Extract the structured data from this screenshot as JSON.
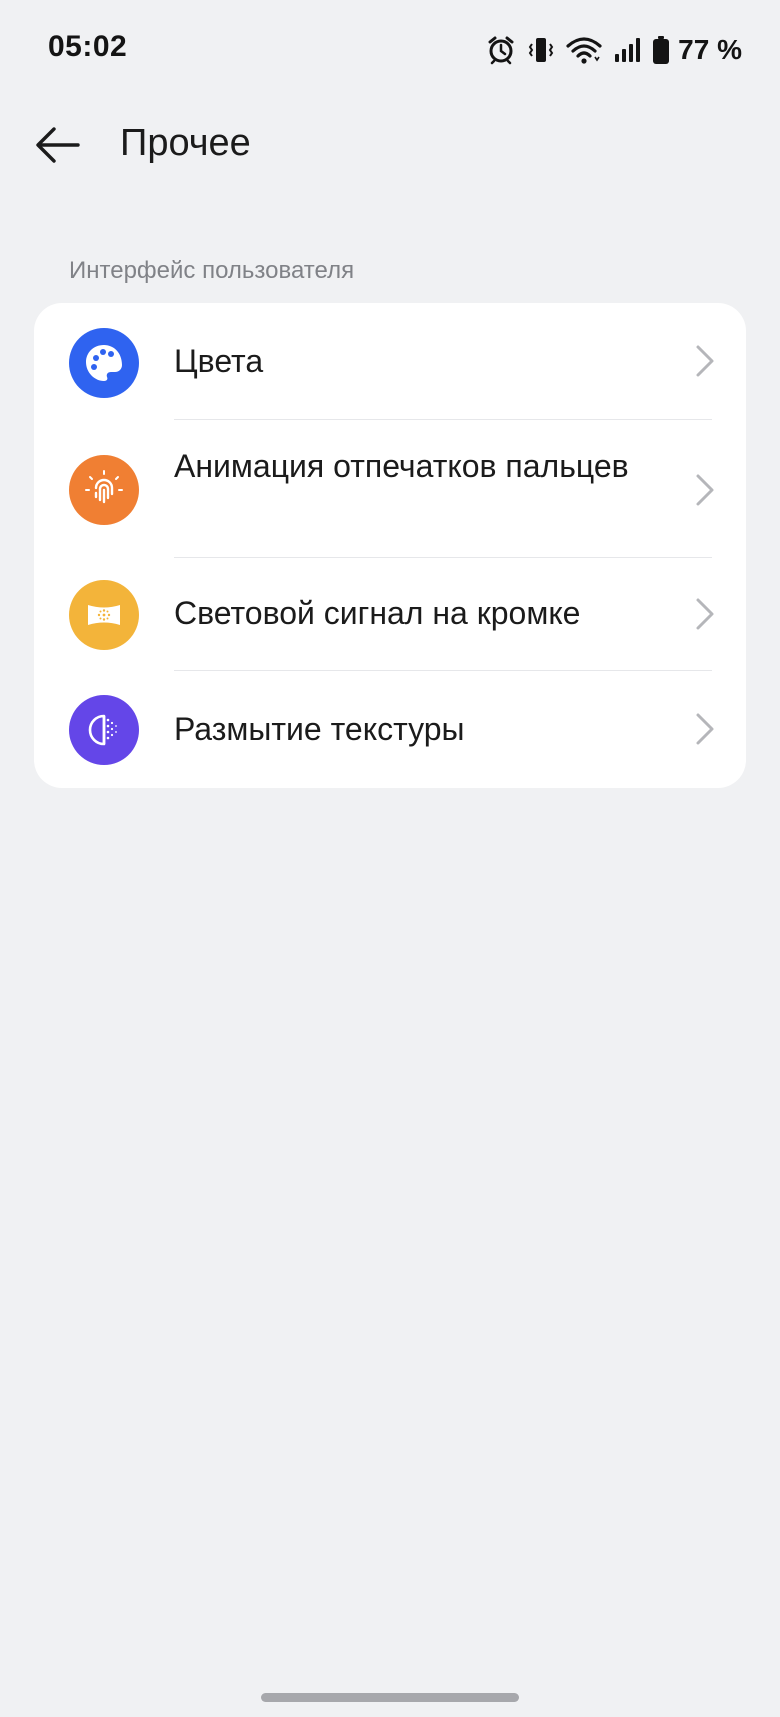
{
  "status_bar": {
    "time": "05:02",
    "battery_percent": "77 %",
    "icons": [
      "alarm-icon",
      "vibrate-icon",
      "wifi-icon",
      "signal-icon",
      "battery-icon"
    ]
  },
  "header": {
    "title": "Прочее",
    "back_icon": "arrow-left-icon"
  },
  "section": {
    "label": "Интерфейс пользователя"
  },
  "items": [
    {
      "label": "Цвета",
      "icon": "palette-icon",
      "color": "#2f63f0"
    },
    {
      "label": "Анимация отпечатков пальцев",
      "icon": "fingerprint-icon",
      "color": "#f07f33"
    },
    {
      "label": "Световой сигнал на кромке",
      "icon": "edge-light-icon",
      "color": "#f3b43a"
    },
    {
      "label": "Размытие текстуры",
      "icon": "blur-texture-icon",
      "color": "#6446e8"
    }
  ],
  "colors": {
    "background": "#f0f1f3",
    "card": "#ffffff",
    "chevron": "#b5b6ba"
  }
}
